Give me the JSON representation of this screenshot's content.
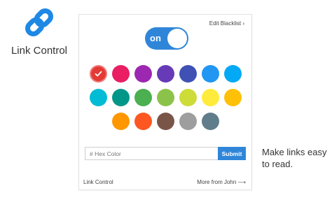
{
  "brand": {
    "name": "Link Control",
    "logo_icon": "link-chain-icon",
    "logo_color": "#1e88e5"
  },
  "panel": {
    "blacklist_link": "Edit Blacklist ›",
    "toggle": {
      "label": "on",
      "state": "on",
      "color": "#2f86d9"
    },
    "swatch_rows": [
      [
        "#e53935",
        "#e91e63",
        "#9c27b0",
        "#673ab7",
        "#3f51b5",
        "#2196f3",
        "#03a9f4"
      ],
      [
        "#00bcd4",
        "#009688",
        "#4caf50",
        "#8bc34a",
        "#cddc39",
        "#ffeb3b",
        "#ffc107"
      ],
      [
        "#ff9800",
        "#ff5722",
        "#795548",
        "#9e9e9e",
        "#607d8b"
      ]
    ],
    "selected_swatch": "#e53935",
    "hex_input": {
      "placeholder": "# Hex Color",
      "value": ""
    },
    "submit_label": "Submit",
    "footer_left": "Link Control",
    "footer_right": "More from John ⟶"
  },
  "tagline": "Make links easy to read."
}
